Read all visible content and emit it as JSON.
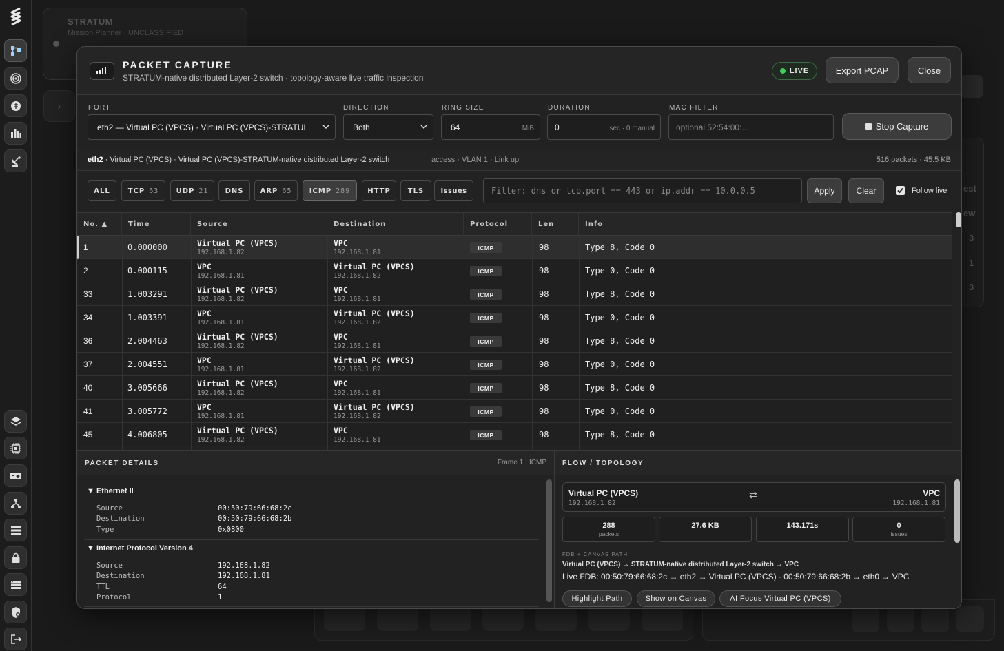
{
  "app": {
    "name": "STRATUM",
    "subtitle": "Mission Planner · UNCLASSIFIED"
  },
  "background": {
    "right_texts": [
      "est",
      "ew",
      "3",
      "1",
      "3"
    ]
  },
  "rail": {
    "top_icons": [
      "topology-icon",
      "radar-icon",
      "brain-icon",
      "city-icon",
      "satellite-dish-icon"
    ],
    "bottom_icons": [
      "layers-icon",
      "cpu-icon",
      "gpu-card-icon",
      "network-fork-icon",
      "server-list-icon",
      "lock-icon",
      "storage-icon",
      "shield-gear-icon",
      "logout-icon"
    ]
  },
  "modal": {
    "title": "PACKET CAPTURE",
    "subtitle": "STRATUM-native distributed Layer-2 switch · topology-aware live traffic inspection",
    "live_label": "LIVE",
    "export_label": "Export PCAP",
    "close_label": "Close"
  },
  "controls": {
    "port_label": "PORT",
    "port_value": "eth2 — Virtual PC (VPCS) · Virtual PC (VPCS)-STRATUI",
    "direction_label": "DIRECTION",
    "direction_value": "Both",
    "ring_label": "RING SIZE",
    "ring_value": "64",
    "ring_unit": "MiB",
    "duration_label": "DURATION",
    "duration_value": "0",
    "duration_unit": "sec · 0 manual",
    "mac_label": "MAC FILTER",
    "mac_placeholder": "optional 52:54:00:...",
    "stop_label": "Stop Capture"
  },
  "infobar": {
    "port": "eth2",
    "desc": " · Virtual PC (VPCS) · Virtual PC (VPCS)-STRATUM-native distributed Layer-2 switch",
    "meta": "access · VLAN 1 · Link up",
    "count": "516 packets · 45.5 KB"
  },
  "chips": [
    {
      "label": "ALL",
      "count": ""
    },
    {
      "label": "TCP",
      "count": "63"
    },
    {
      "label": "UDP",
      "count": "21"
    },
    {
      "label": "DNS",
      "count": ""
    },
    {
      "label": "ARP",
      "count": "65"
    },
    {
      "label": "ICMP",
      "count": "289"
    },
    {
      "label": "HTTP",
      "count": ""
    },
    {
      "label": "TLS",
      "count": ""
    },
    {
      "label": "Issues",
      "count": ""
    }
  ],
  "filter": {
    "placeholder": "Filter: dns or tcp.port == 443 or ip.addr == 10.0.0.5",
    "apply_label": "Apply",
    "clear_label": "Clear",
    "follow_label": "Follow live"
  },
  "table": {
    "headers": [
      "No. ▲",
      "Time",
      "Source",
      "Destination",
      "Protocol",
      "Len",
      "Info"
    ],
    "rows": [
      {
        "no": "1",
        "time": "0.000000",
        "src": "Virtual PC (VPCS)",
        "src_ip": "192.168.1.82",
        "dst": "VPC",
        "dst_ip": "192.168.1.81",
        "proto": "ICMP",
        "len": "98",
        "info": "Type 8, Code 0"
      },
      {
        "no": "2",
        "time": "0.000115",
        "src": "VPC",
        "src_ip": "192.168.1.81",
        "dst": "Virtual PC (VPCS)",
        "dst_ip": "192.168.1.82",
        "proto": "ICMP",
        "len": "98",
        "info": "Type 0, Code 0"
      },
      {
        "no": "33",
        "time": "1.003291",
        "src": "Virtual PC (VPCS)",
        "src_ip": "192.168.1.82",
        "dst": "VPC",
        "dst_ip": "192.168.1.81",
        "proto": "ICMP",
        "len": "98",
        "info": "Type 8, Code 0"
      },
      {
        "no": "34",
        "time": "1.003391",
        "src": "VPC",
        "src_ip": "192.168.1.81",
        "dst": "Virtual PC (VPCS)",
        "dst_ip": "192.168.1.82",
        "proto": "ICMP",
        "len": "98",
        "info": "Type 0, Code 0"
      },
      {
        "no": "36",
        "time": "2.004463",
        "src": "Virtual PC (VPCS)",
        "src_ip": "192.168.1.82",
        "dst": "VPC",
        "dst_ip": "192.168.1.81",
        "proto": "ICMP",
        "len": "98",
        "info": "Type 8, Code 0"
      },
      {
        "no": "37",
        "time": "2.004551",
        "src": "VPC",
        "src_ip": "192.168.1.81",
        "dst": "Virtual PC (VPCS)",
        "dst_ip": "192.168.1.82",
        "proto": "ICMP",
        "len": "98",
        "info": "Type 0, Code 0"
      },
      {
        "no": "40",
        "time": "3.005666",
        "src": "Virtual PC (VPCS)",
        "src_ip": "192.168.1.82",
        "dst": "VPC",
        "dst_ip": "192.168.1.81",
        "proto": "ICMP",
        "len": "98",
        "info": "Type 8, Code 0"
      },
      {
        "no": "41",
        "time": "3.005772",
        "src": "VPC",
        "src_ip": "192.168.1.81",
        "dst": "Virtual PC (VPCS)",
        "dst_ip": "192.168.1.82",
        "proto": "ICMP",
        "len": "98",
        "info": "Type 0, Code 0"
      },
      {
        "no": "45",
        "time": "4.006805",
        "src": "Virtual PC (VPCS)",
        "src_ip": "192.168.1.82",
        "dst": "VPC",
        "dst_ip": "192.168.1.81",
        "proto": "ICMP",
        "len": "98",
        "info": "Type 8, Code 0"
      }
    ]
  },
  "details": {
    "title": "PACKET DETAILS",
    "frame": "Frame 1 · ICMP",
    "ethernet": {
      "title": "▼ Ethernet II",
      "fields": [
        {
          "k": "Source",
          "v": "00:50:79:66:68:2c"
        },
        {
          "k": "Destination",
          "v": "00:50:79:66:68:2b"
        },
        {
          "k": "Type",
          "v": "0x0800"
        }
      ]
    },
    "ipv4": {
      "title": "▼ Internet Protocol Version 4",
      "fields": [
        {
          "k": "Source",
          "v": "192.168.1.82"
        },
        {
          "k": "Destination",
          "v": "192.168.1.81"
        },
        {
          "k": "TTL",
          "v": "64"
        },
        {
          "k": "Protocol",
          "v": "1"
        }
      ]
    }
  },
  "flow": {
    "title": "FLOW / TOPOLOGY",
    "src": "Virtual PC (VPCS)",
    "src_ip": "192.168.1.82",
    "arrow": "⇄",
    "dst": "VPC",
    "dst_ip": "192.168.1.81",
    "stats": [
      {
        "v": "288",
        "l": "packets"
      },
      {
        "v": "27.6 KB",
        "l": ""
      },
      {
        "v": "143.171s",
        "l": ""
      },
      {
        "v": "0",
        "l": "issues"
      }
    ],
    "fdb_label": "FDB + CANVAS PATH",
    "fdb_path": "Virtual PC (VPCS) → STRATUM-native distributed Layer-2 switch → VPC",
    "fdb_live": "Live FDB: 00:50:79:66:68:2c → eth2 → Virtual PC (VPCS) · 00:50:79:66:68:2b → eth0 → VPC",
    "buttons": [
      "Highlight Path",
      "Show on Canvas",
      "AI Focus Virtual PC (VPCS)"
    ]
  }
}
